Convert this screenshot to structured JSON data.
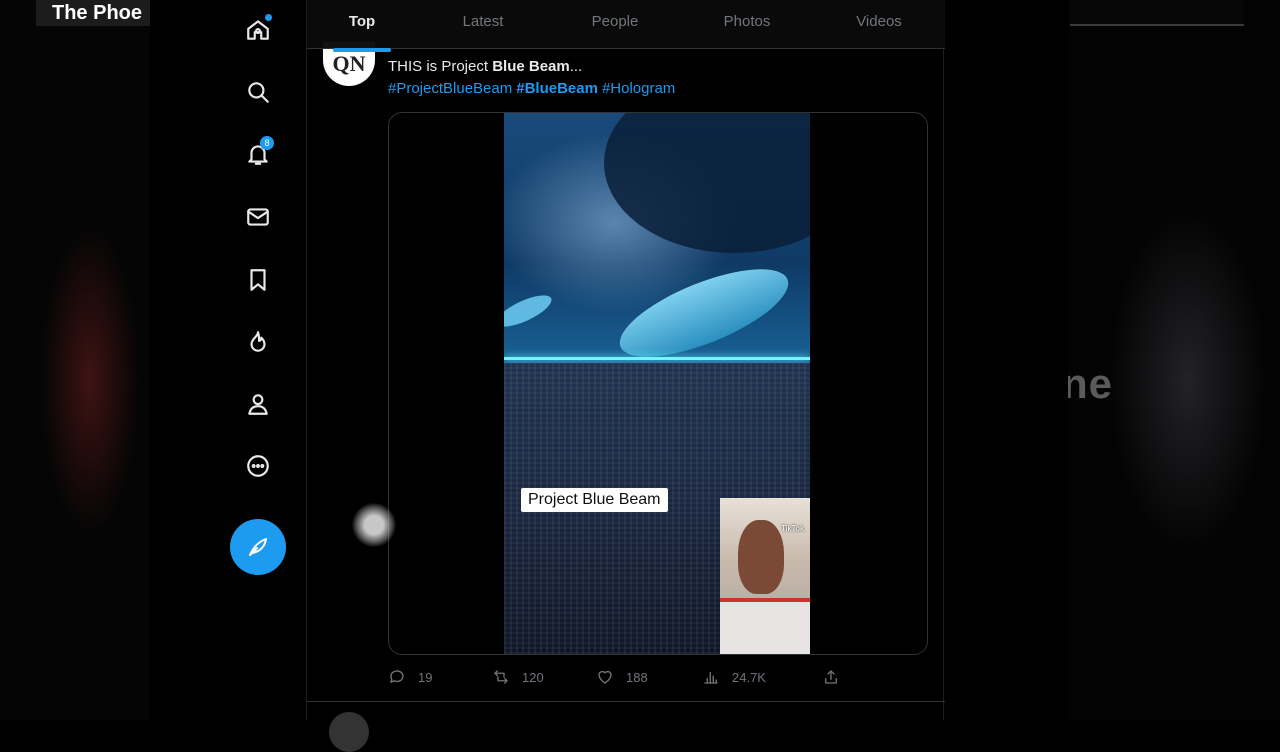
{
  "background": {
    "left_title": "The Phoe",
    "right_text": "ne"
  },
  "nav": {
    "items": [
      {
        "name": "home",
        "icon": "home-icon"
      },
      {
        "name": "explore",
        "icon": "search-icon"
      },
      {
        "name": "notifications",
        "icon": "bell-icon",
        "badge": "8"
      },
      {
        "name": "messages",
        "icon": "mail-icon"
      },
      {
        "name": "bookmarks",
        "icon": "bookmark-icon"
      },
      {
        "name": "topics",
        "icon": "flame-icon"
      },
      {
        "name": "profile",
        "icon": "person-icon"
      },
      {
        "name": "more",
        "icon": "more-icon"
      }
    ],
    "compose_icon": "feather-icon",
    "accent_color": "#1d9bf0"
  },
  "tabs": [
    {
      "label": "Top",
      "active": true
    },
    {
      "label": "Latest",
      "active": false
    },
    {
      "label": "People",
      "active": false
    },
    {
      "label": "Photos",
      "active": false
    },
    {
      "label": "Videos",
      "active": false
    }
  ],
  "tweet": {
    "avatar_text": "QN",
    "text_prefix": "THIS is Project ",
    "text_bold": "Blue Beam",
    "text_suffix": "...",
    "hashtags": [
      "#ProjectBlueBeam",
      "#BlueBeam",
      "#Hologram"
    ],
    "media": {
      "caption": "Project Blue Beam",
      "watermark": "TikTok"
    },
    "stats": {
      "replies": "19",
      "retweets": "120",
      "likes": "188",
      "views": "24.7K"
    }
  }
}
